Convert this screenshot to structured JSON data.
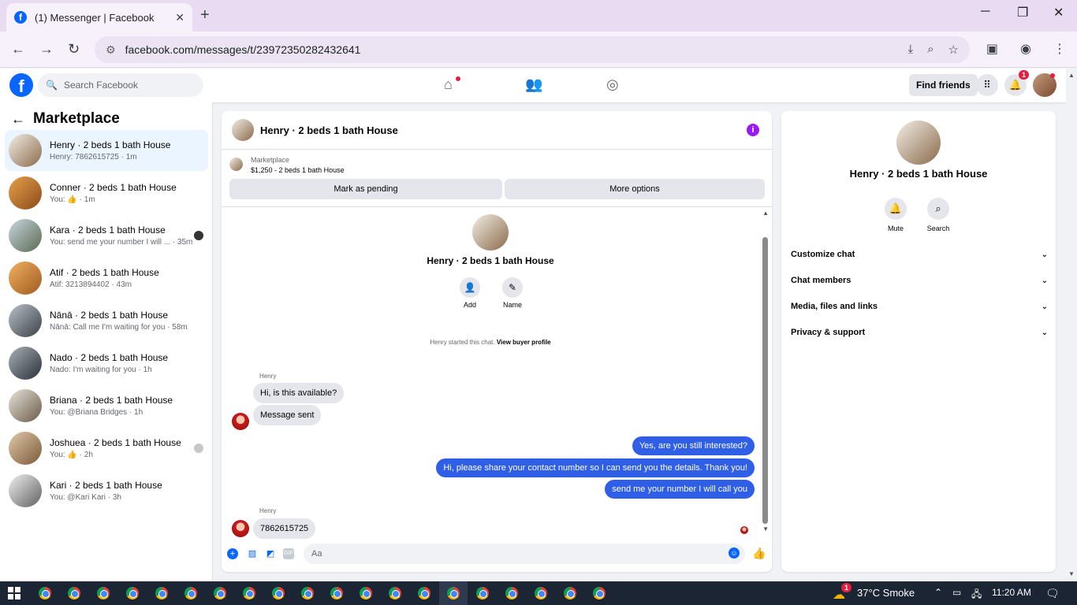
{
  "browser": {
    "tab_title": "(1) Messenger | Facebook",
    "url": "facebook.com/messages/t/23972350282432641",
    "tab_close": "✕",
    "new_tab": "+"
  },
  "fb": {
    "search_placeholder": "Search Facebook",
    "find_friends": "Find friends",
    "notif_count": "1"
  },
  "sidebar": {
    "title": "Marketplace",
    "conversations": [
      {
        "name": "Henry · 2 beds 1 bath House",
        "preview": "Henry: 7862615725 · 1m",
        "active": true
      },
      {
        "name": "Conner · 2 beds 1 bath House",
        "preview": "You: 👍 · 1m"
      },
      {
        "name": "Kara · 2 beds 1 bath House",
        "preview": "You: send me your number I will ... · 35m"
      },
      {
        "name": "Atif · 2 beds 1 bath House",
        "preview": "Atif: 3213894402 · 43m"
      },
      {
        "name": "Nānā · 2 beds 1 bath House",
        "preview": "Nānā: Call me I'm waiting for you · 58m"
      },
      {
        "name": "Nado · 2 beds 1 bath House",
        "preview": "Nado: I'm waiting for you · 1h"
      },
      {
        "name": "Briana · 2 beds 1 bath House",
        "preview": "You: @Briana Bridges · 1h"
      },
      {
        "name": "Joshuea · 2 beds 1 bath House",
        "preview": "You: 👍 · 2h"
      },
      {
        "name": "Kari · 2 beds 1 bath House",
        "preview": "You: @Kari Kari · 3h"
      }
    ]
  },
  "chat": {
    "title": "Henry · 2 beds 1 bath House",
    "listing_label": "Marketplace",
    "listing_price": "$1,250 - 2 beds 1 bath House",
    "mark_pending": "Mark as pending",
    "more_options": "More options",
    "profile_name": "Henry · 2 beds 1 bath House",
    "add_label": "Add",
    "name_label": "Name",
    "system_text": "Henry started this chat.",
    "view_profile": "View buyer profile",
    "sender_name": "Henry",
    "msg_in_1": "Hi, is this available?",
    "msg_in_2": "Message sent",
    "msg_out_1": "Yes, are you still interested?",
    "msg_out_2": "Hi, please share your contact number so I can send you the details. Thank you!",
    "msg_out_3": "send me your number I will call you",
    "msg_in_3": "7862615725",
    "input_placeholder": "Aa",
    "gif_label": "GIF"
  },
  "details": {
    "name": "Henry · 2 beds 1 bath House",
    "mute": "Mute",
    "search": "Search",
    "rows": [
      "Customize chat",
      "Chat members",
      "Media, files and links",
      "Privacy & support"
    ]
  },
  "taskbar": {
    "weather": "37°C  Smoke",
    "time": "11:20 AM",
    "weather_badge": "1"
  }
}
